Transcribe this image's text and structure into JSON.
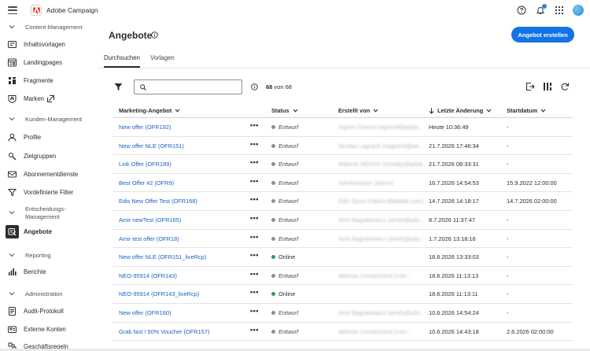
{
  "app": {
    "name": "Adobe Campaign"
  },
  "sidebar": {
    "sections": [
      {
        "label": "Content-Management"
      },
      {
        "label": "Kunden-Management"
      },
      {
        "label": "Entscheidungs-"
      },
      {
        "label": "Management"
      },
      {
        "label": "Reporting"
      },
      {
        "label": "Administration"
      }
    ],
    "items": [
      {
        "label": "Inhaltsvorlagen",
        "icon": "template-icon"
      },
      {
        "label": "Landingpages",
        "icon": "landingpage-icon"
      },
      {
        "label": "Fragmente",
        "icon": "fragment-icon"
      },
      {
        "label": "Marken",
        "icon": "brand-icon"
      },
      {
        "label": "Profile",
        "icon": "profile-icon"
      },
      {
        "label": "Zielgruppen",
        "icon": "audience-icon"
      },
      {
        "label": "Abonnementdienste",
        "icon": "subscription-icon"
      },
      {
        "label": "Vordefinierte Filter",
        "icon": "filter-icon"
      },
      {
        "label": "Angebote",
        "icon": "offer-icon"
      },
      {
        "label": "Berichte",
        "icon": "report-icon"
      },
      {
        "label": "Audit-Protokoll",
        "icon": "audit-icon"
      },
      {
        "label": "Externe Konten",
        "icon": "accounts-icon"
      },
      {
        "label": "Geschäftsregeln",
        "icon": "rules-icon"
      }
    ]
  },
  "main": {
    "title": "Angebote",
    "create_button": "Angebot erstellen",
    "tabs": [
      {
        "label": "Durchsuchen"
      },
      {
        "label": "Vorlagen"
      }
    ],
    "search": {
      "placeholder": "",
      "value": ""
    },
    "count": {
      "shown": "68",
      "suffix": " von 68"
    }
  },
  "table": {
    "columns": [
      "Marketing-Angebot",
      "Status",
      "Erstellt von",
      "Letzte Änderung",
      "Startdatum"
    ],
    "sorted_column": "Letzte Änderung",
    "status_colors": {
      "Entwurf": "#8e8e8e",
      "Online": "#2d9d4d"
    },
    "rows": [
      {
        "name": "New offer (OFR192)",
        "status": "Entwurf",
        "created_by": "Vignes Florent (vignesfl@adob...",
        "modified": "Heute 10:36:49",
        "start": "-"
      },
      {
        "name": "New offer NLE (OFR151)",
        "status": "Entwurf",
        "created_by": "Nicolas Lagrand (nlagrand@ad...",
        "modified": "21.7.2026 17:46:34",
        "start": "-"
      },
      {
        "name": "Link Offer (OFR189)",
        "status": "Entwurf",
        "created_by": "Mahesh REDDY (mreddy@adob...",
        "modified": "21.7.2026 08:33:31",
        "start": "-"
      },
      {
        "name": "Best Offer #2 (OFR9)",
        "status": "Entwurf",
        "created_by": "Administrator (admin)",
        "modified": "16.7.2026 14:54:53",
        "start": "15.9.2022 12:00:00"
      },
      {
        "name": "Edis New Offer Test (OFR168)",
        "status": "Entwurf",
        "created_by": "Edis Djuric (edjuric@adobe.com)",
        "modified": "14.7.2026 14:18:17",
        "start": "14.7.2026 02:00:00"
      },
      {
        "name": "Amir newTest (OFR165)",
        "status": "Entwurf",
        "created_by": "Amir Bagrakiewicz (amirb@ado...",
        "modified": "8.7.2026 11:37:47",
        "start": "-"
      },
      {
        "name": "Amir test offer (OFR18)",
        "status": "Entwurf",
        "created_by": "Amir Bagrakiewicz (amirb@ado...",
        "modified": "1.7.2026 13:18:16",
        "start": "-"
      },
      {
        "name": "New offer NLE (OFR151_liveRcp)",
        "status": "Online",
        "created_by": "",
        "modified": "18.6.2026 13:33:03",
        "start": "-"
      },
      {
        "name": "NEO-95914 (OFR143)",
        "status": "Entwurf",
        "created_by": "abhinav Comarmond (com...",
        "modified": "18.6.2026 11:13:13",
        "start": "-"
      },
      {
        "name": "NEO-95914 (OFR143_liveRcp)",
        "status": "Online",
        "created_by": "",
        "modified": "18.6.2026 11:13:11",
        "start": "-"
      },
      {
        "name": "New offer (OFR160)",
        "status": "Entwurf",
        "created_by": "Amir Bagrakiewicz (amirb@ado...",
        "modified": "10.6.2026 14:54:24",
        "start": "-"
      },
      {
        "name": "Grab fast ! 50% Voucher (OFR157)",
        "status": "Entwurf",
        "created_by": "abhinav Comarmond (com...",
        "modified": "10.6.2026 14:43:18",
        "start": "2.6.2026 02:00:00"
      }
    ],
    "more_glyph": "•••"
  }
}
